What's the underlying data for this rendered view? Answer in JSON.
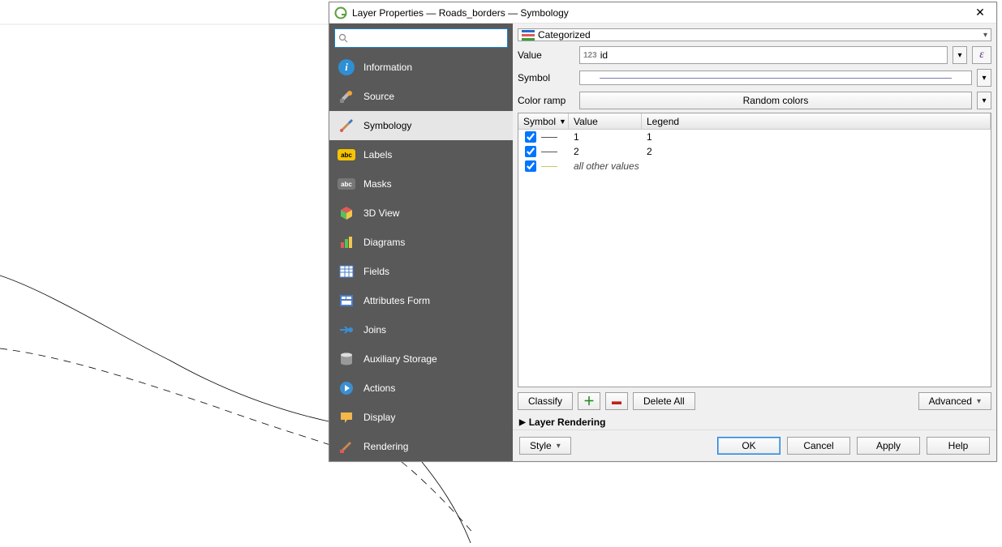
{
  "title": "Layer Properties — Roads_borders — Symbology",
  "search": {
    "placeholder": ""
  },
  "nav": {
    "information": "Information",
    "source": "Source",
    "symbology": "Symbology",
    "labels": "Labels",
    "masks": "Masks",
    "view3d": "3D View",
    "diagrams": "Diagrams",
    "fields": "Fields",
    "attrform": "Attributes Form",
    "joins": "Joins",
    "auxstorage": "Auxiliary Storage",
    "actions": "Actions",
    "display": "Display",
    "rendering": "Rendering"
  },
  "renderer_type": "Categorized",
  "value_label": "Value",
  "value_field_prefix": "123",
  "value_field": "id",
  "symbol_label": "Symbol",
  "color_ramp_label": "Color ramp",
  "color_ramp_value": "Random colors",
  "table": {
    "headers": {
      "symbol": "Symbol",
      "value": "Value",
      "legend": "Legend"
    },
    "rows": [
      {
        "checked": true,
        "value": "1",
        "legend": "1",
        "other": false
      },
      {
        "checked": true,
        "value": "2",
        "legend": "2",
        "other": false
      },
      {
        "checked": true,
        "value": "all other values",
        "legend": "",
        "other": true
      }
    ]
  },
  "buttons": {
    "classify": "Classify",
    "delete_all": "Delete All",
    "advanced": "Advanced",
    "layer_rendering": "Layer Rendering",
    "style": "Style",
    "ok": "OK",
    "cancel": "Cancel",
    "apply": "Apply",
    "help": "Help"
  }
}
